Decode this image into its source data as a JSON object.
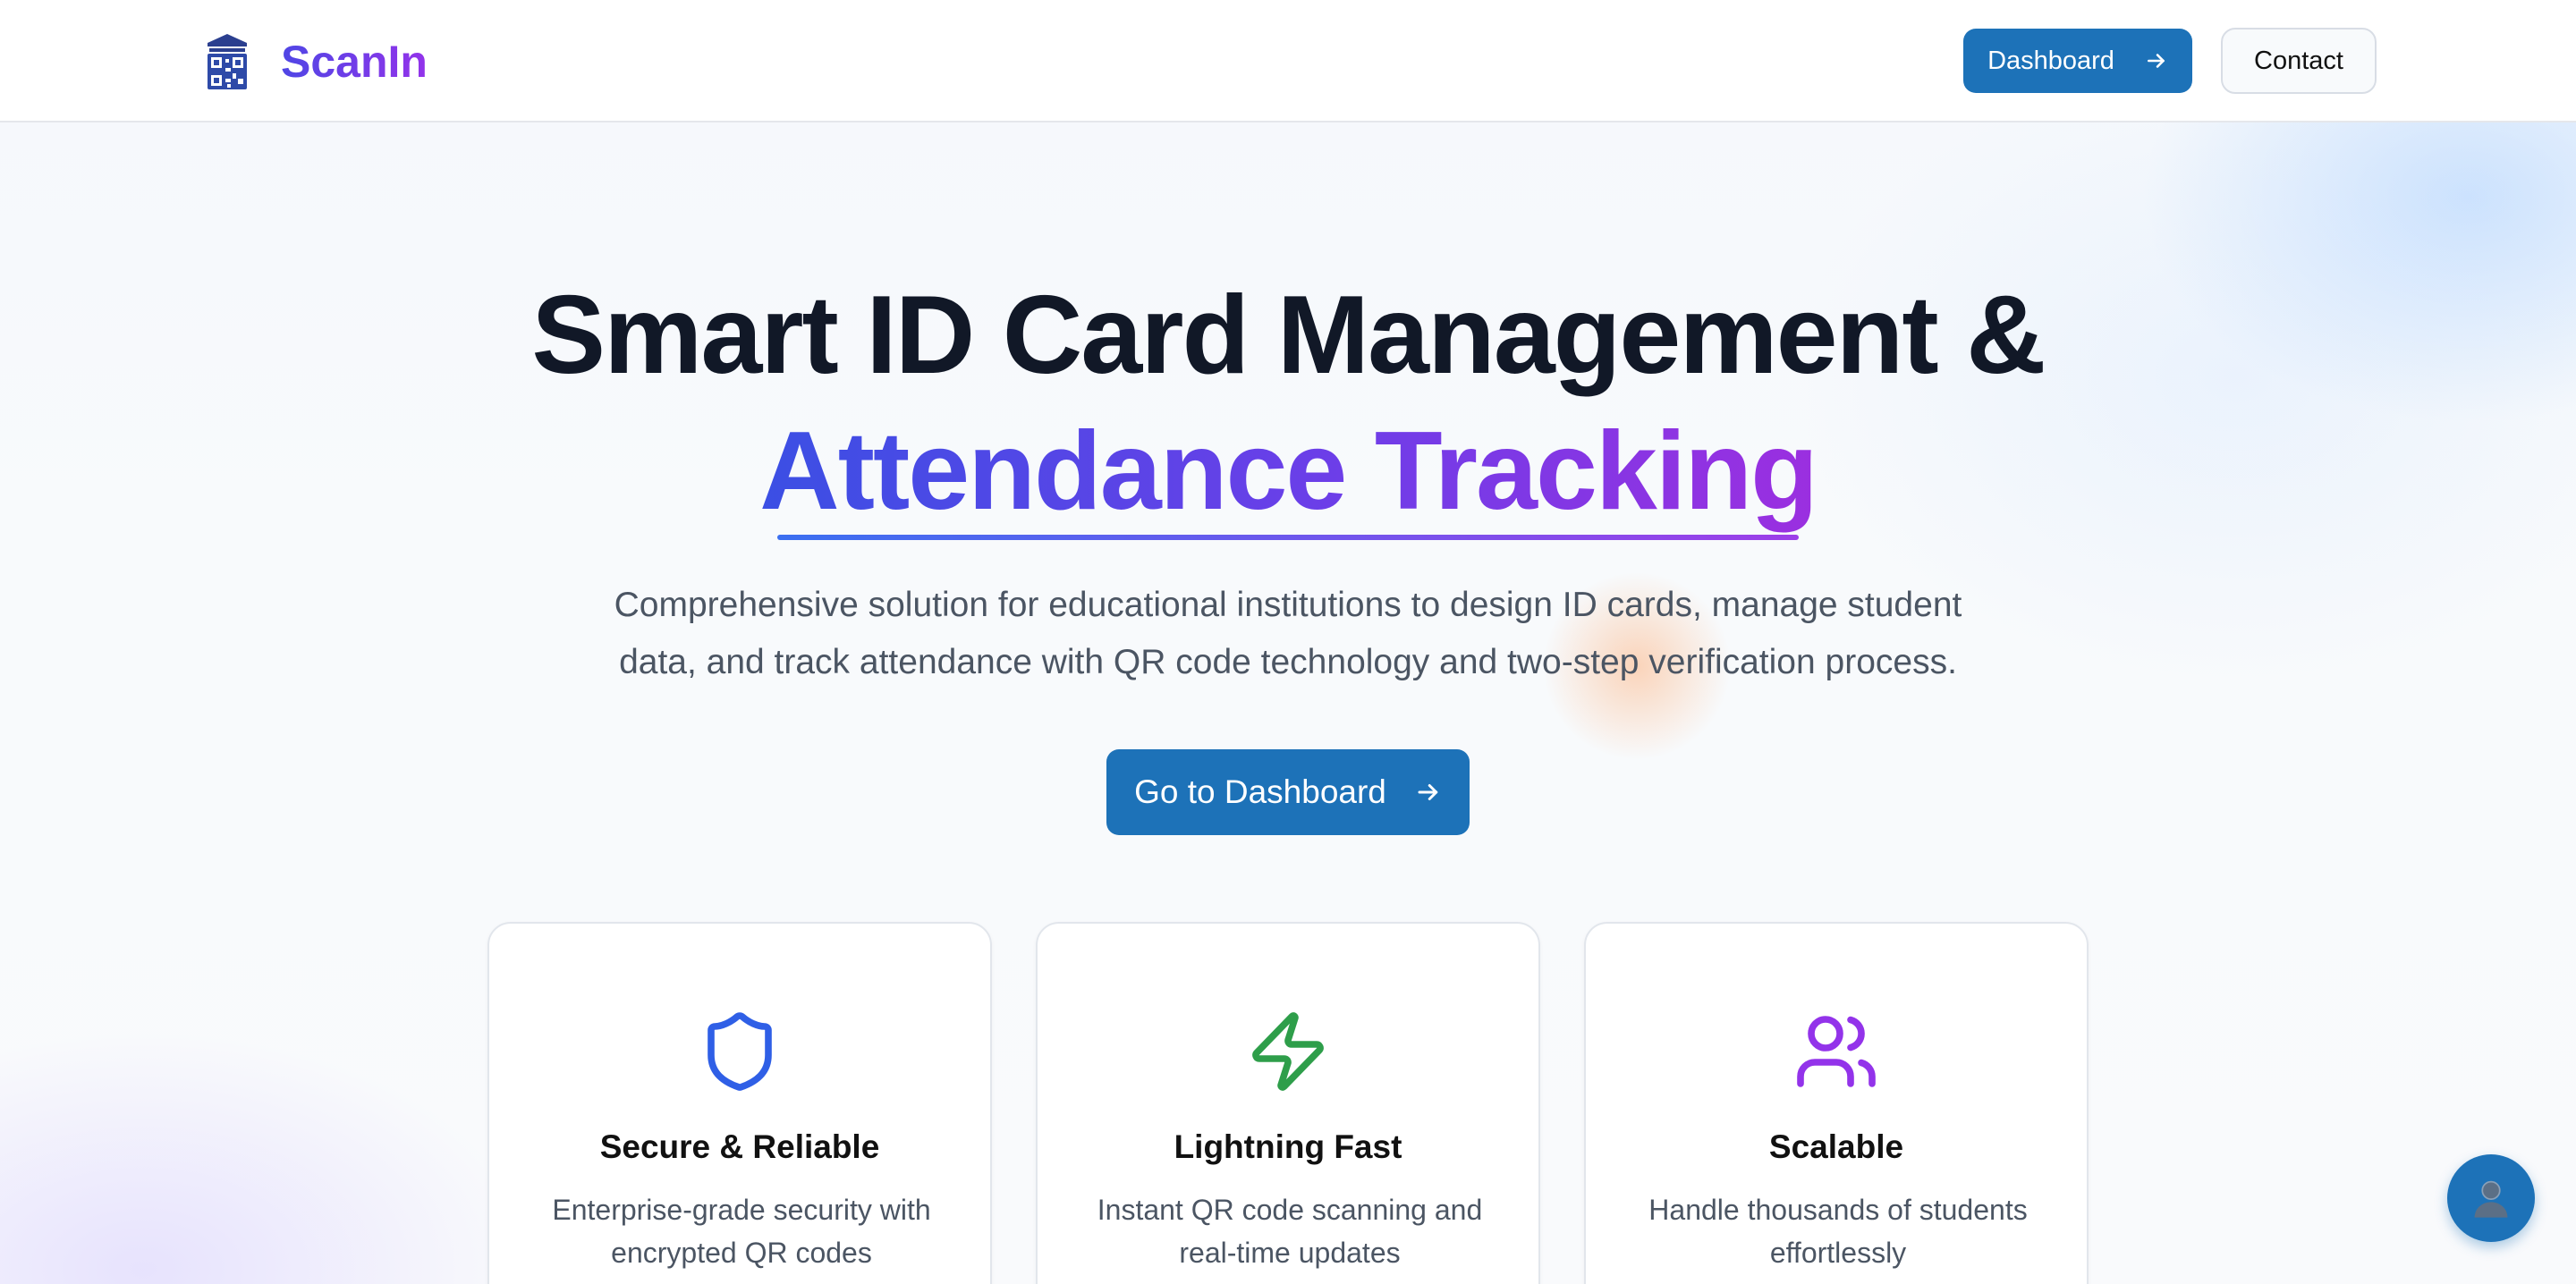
{
  "colors": {
    "primary": "#1d72b8",
    "brand_gradient_start": "#4f46e5",
    "brand_gradient_end": "#9333ea",
    "heading": "#111827",
    "body_text": "#4b5563",
    "icon_secure": "#2f5fe6",
    "icon_fast": "#2e9e4a",
    "icon_scalable": "#9333ea"
  },
  "header": {
    "brand_name": "ScanIn",
    "logo_icon": "building-qr-icon",
    "dashboard_label": "Dashboard",
    "dashboard_icon": "arrow-right-icon",
    "contact_label": "Contact"
  },
  "hero": {
    "title_line1": "Smart ID Card Management &",
    "title_line2": "Attendance Tracking",
    "subtitle_line1": "Comprehensive solution for educational institutions to design ID cards, manage student",
    "subtitle_line2": "data, and track attendance with QR code technology and two-step verification process.",
    "cta_label": "Go to Dashboard",
    "cta_icon": "arrow-right-icon"
  },
  "features": [
    {
      "icon": "shield-icon",
      "title": "Secure & Reliable",
      "desc_line1": "Enterprise-grade security with",
      "desc_line2": "encrypted QR codes"
    },
    {
      "icon": "lightning-icon",
      "title": "Lightning Fast",
      "desc_line1": "Instant QR code scanning and",
      "desc_line2": "real-time updates"
    },
    {
      "icon": "users-icon",
      "title": "Scalable",
      "desc_line1": "Handle thousands of students",
      "desc_line2": "effortlessly"
    }
  ],
  "fab": {
    "icon": "user-avatar-icon"
  }
}
